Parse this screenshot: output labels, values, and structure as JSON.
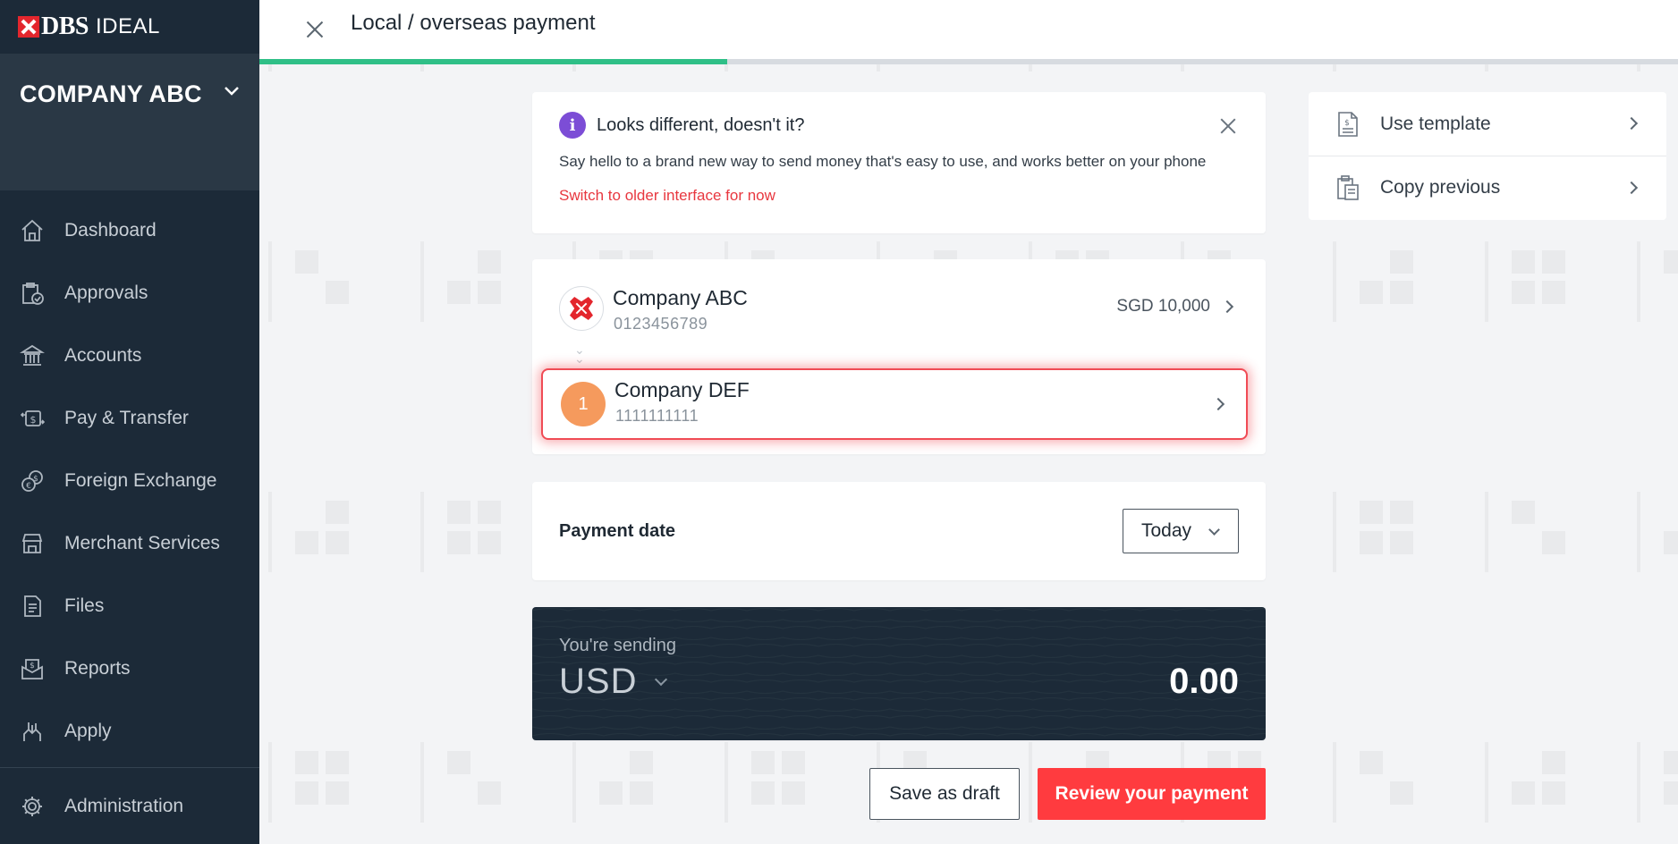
{
  "brand": {
    "name": "DBS",
    "product": "IDEAL",
    "accent_color": "#e3262d"
  },
  "company_switcher": {
    "label": "COMPANY ABC"
  },
  "sidebar": {
    "items": [
      {
        "label": "Dashboard",
        "icon": "home-icon"
      },
      {
        "label": "Approvals",
        "icon": "clipboard-check-icon"
      },
      {
        "label": "Accounts",
        "icon": "bank-icon"
      },
      {
        "label": "Pay & Transfer",
        "icon": "money-transfer-icon"
      },
      {
        "label": "Foreign Exchange",
        "icon": "currency-exchange-icon"
      },
      {
        "label": "Merchant Services",
        "icon": "storefront-icon"
      },
      {
        "label": "Files",
        "icon": "file-icon"
      },
      {
        "label": "Reports",
        "icon": "report-icon"
      },
      {
        "label": "Apply",
        "icon": "apply-icon"
      }
    ],
    "admin": {
      "label": "Administration",
      "icon": "gear-icon"
    }
  },
  "header": {
    "title": "Local / overseas payment",
    "progress_percent": 33
  },
  "notice": {
    "title": "Looks different, doesn't it?",
    "body": "Say hello to a brand new way to send money that's easy to use, and works better on your phone",
    "link": "Switch to older interface for now"
  },
  "payment": {
    "from": {
      "name": "Company ABC",
      "account": "0123456789",
      "balance": "SGD 10,000"
    },
    "to": {
      "badge": "1",
      "name": "Company DEF",
      "account": "1111111111"
    },
    "date": {
      "label": "Payment date",
      "value": "Today"
    },
    "sending": {
      "label": "You're sending",
      "currency": "USD",
      "amount": "0.00"
    }
  },
  "actions": {
    "draft": "Save as draft",
    "review": "Review your payment"
  },
  "shortcuts": [
    {
      "label": "Use template",
      "icon": "template-icon"
    },
    {
      "label": "Copy previous",
      "icon": "clipboard-copy-icon"
    }
  ],
  "colors": {
    "progress": "#2fbf87",
    "primary_button": "#ff3b3f",
    "sidebar": "#1c2a38",
    "highlight_border": "#f04b55"
  }
}
